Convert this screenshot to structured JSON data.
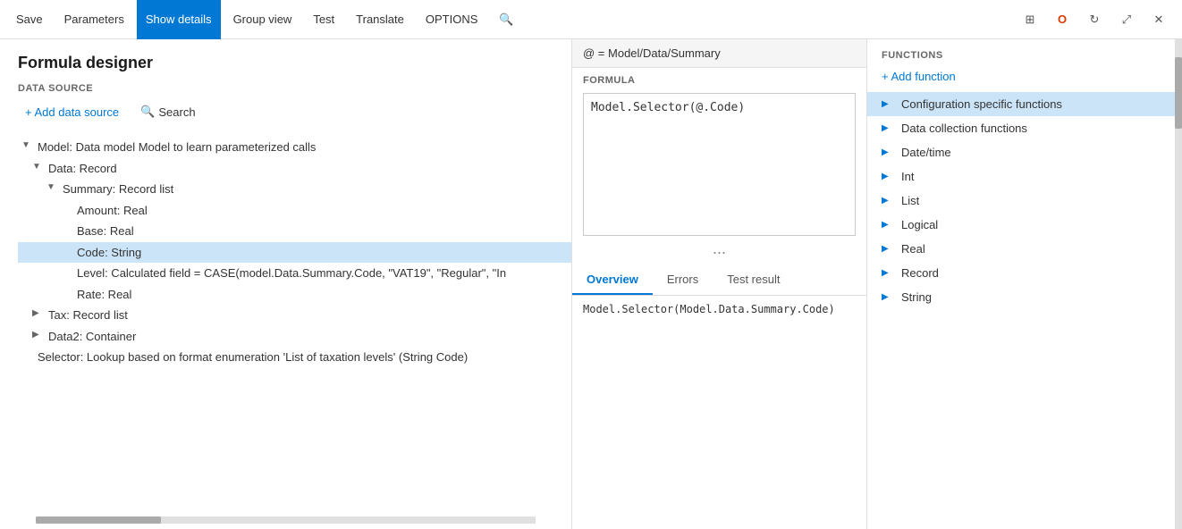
{
  "titlebar": {
    "save_label": "Save",
    "params_label": "Parameters",
    "show_details_label": "Show details",
    "group_view_label": "Group view",
    "test_label": "Test",
    "translate_label": "Translate",
    "options_label": "OPTIONS"
  },
  "left_panel": {
    "title": "Formula designer",
    "data_source_label": "DATA SOURCE",
    "add_data_source_label": "+ Add data source",
    "search_label": "Search",
    "tree": [
      {
        "level": 0,
        "expanded": true,
        "text": "Model: Data model Model to learn parameterized calls",
        "selected": false
      },
      {
        "level": 1,
        "expanded": true,
        "text": "Data: Record",
        "selected": false
      },
      {
        "level": 2,
        "expanded": true,
        "text": "Summary: Record list",
        "selected": false
      },
      {
        "level": 3,
        "expanded": false,
        "text": "Amount: Real",
        "selected": false
      },
      {
        "level": 3,
        "expanded": false,
        "text": "Base: Real",
        "selected": false
      },
      {
        "level": 3,
        "expanded": false,
        "text": "Code: String",
        "selected": true
      },
      {
        "level": 3,
        "expanded": false,
        "text": "Level: Calculated field = CASE(model.Data.Summary.Code, \"VAT19\", \"Regular\", \"In",
        "selected": false
      },
      {
        "level": 3,
        "expanded": false,
        "text": "Rate: Real",
        "selected": false
      },
      {
        "level": 1,
        "expanded": false,
        "text": "Tax: Record list",
        "selected": false
      },
      {
        "level": 1,
        "expanded": false,
        "text": "Data2: Container",
        "selected": false
      },
      {
        "level": 0,
        "expanded": false,
        "text": "Selector: Lookup based on format enumeration 'List of taxation levels' (String Code)",
        "selected": false
      }
    ]
  },
  "formula_panel": {
    "path": "@ = Model/Data/Summary",
    "formula_label": "FORMULA",
    "formula_text": "Model.Selector(@.Code)",
    "more": "...",
    "tabs": [
      {
        "label": "Overview",
        "active": true
      },
      {
        "label": "Errors",
        "active": false
      },
      {
        "label": "Test result",
        "active": false
      }
    ],
    "output_text": "Model.Selector(Model.Data.Summary.Code)"
  },
  "functions_panel": {
    "functions_label": "FUNCTIONS",
    "add_function_label": "+ Add function",
    "items": [
      {
        "label": "Configuration specific functions",
        "selected": true
      },
      {
        "label": "Data collection functions",
        "selected": false
      },
      {
        "label": "Date/time",
        "selected": false
      },
      {
        "label": "Int",
        "selected": false
      },
      {
        "label": "List",
        "selected": false
      },
      {
        "label": "Logical",
        "selected": false
      },
      {
        "label": "Real",
        "selected": false
      },
      {
        "label": "Record",
        "selected": false
      },
      {
        "label": "String",
        "selected": false
      }
    ]
  },
  "icons": {
    "chevron_right": "▶",
    "chevron_down": "▼",
    "expand_triangle": "▲",
    "collapse_triangle": "▶",
    "plus": "+",
    "search": "🔍",
    "grid": "⊞",
    "office": "O",
    "refresh": "↻",
    "maximize": "⤢",
    "close": "✕"
  }
}
